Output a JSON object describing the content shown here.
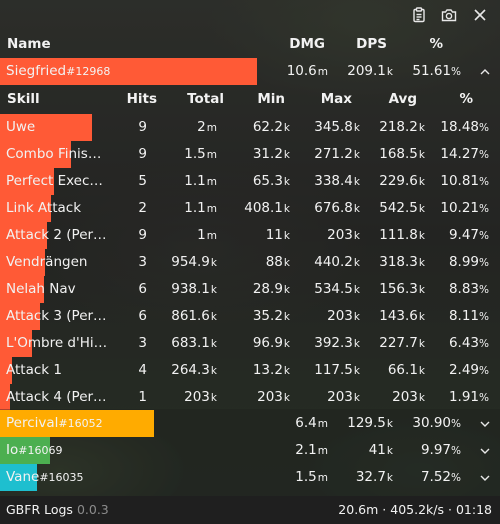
{
  "toolbar": {
    "icons": [
      "clipboard-icon",
      "camera-icon",
      "close-icon"
    ]
  },
  "header": {
    "name": "Name",
    "dmg": "DMG",
    "dps": "DPS",
    "pct": "%"
  },
  "players": [
    {
      "name": "Siegfried",
      "id": "#12968",
      "dmg": "10.6",
      "dmg_unit": "m",
      "dps": "209.1",
      "dps_unit": "k",
      "pct": "51.61",
      "share": 0.5161,
      "color": "#ff5a36",
      "expanded": true
    },
    {
      "name": "Percival",
      "id": "#16052",
      "dmg": "6.4",
      "dmg_unit": "m",
      "dps": "129.5",
      "dps_unit": "k",
      "pct": "30.90",
      "share": 0.309,
      "color": "#ffab00",
      "expanded": false
    },
    {
      "name": "Io",
      "id": "#16069",
      "dmg": "2.1",
      "dmg_unit": "m",
      "dps": "41",
      "dps_unit": "k",
      "pct": "9.97",
      "share": 0.0997,
      "color": "#4caf50",
      "expanded": false
    },
    {
      "name": "Vane",
      "id": "#16035",
      "dmg": "1.5",
      "dmg_unit": "m",
      "dps": "32.7",
      "dps_unit": "k",
      "pct": "7.52",
      "share": 0.0752,
      "color": "#1ebfcf",
      "expanded": false
    }
  ],
  "skill_header": {
    "skill": "Skill",
    "hits": "Hits",
    "total": "Total",
    "min": "Min",
    "max": "Max",
    "avg": "Avg",
    "pct": "%"
  },
  "skills": [
    {
      "name": "Uwe",
      "hits": "9",
      "total": [
        "2",
        "m"
      ],
      "min": [
        "62.2",
        "k"
      ],
      "max": [
        "345.8",
        "k"
      ],
      "avg": [
        "218.2",
        "k"
      ],
      "pct": "18.48",
      "share": 0.1848
    },
    {
      "name": "Combo Finis…",
      "hits": "9",
      "total": [
        "1.5",
        "m"
      ],
      "min": [
        "31.2",
        "k"
      ],
      "max": [
        "271.2",
        "k"
      ],
      "avg": [
        "168.5",
        "k"
      ],
      "pct": "14.27",
      "share": 0.1427
    },
    {
      "name": "Perfect Exec…",
      "hits": "5",
      "total": [
        "1.1",
        "m"
      ],
      "min": [
        "65.3",
        "k"
      ],
      "max": [
        "338.4",
        "k"
      ],
      "avg": [
        "229.6",
        "k"
      ],
      "pct": "10.81",
      "share": 0.1081
    },
    {
      "name": "Link Attack",
      "hits": "2",
      "total": [
        "1.1",
        "m"
      ],
      "min": [
        "408.1",
        "k"
      ],
      "max": [
        "676.8",
        "k"
      ],
      "avg": [
        "542.5",
        "k"
      ],
      "pct": "10.21",
      "share": 0.1021
    },
    {
      "name": "Attack 2 (Per…",
      "hits": "9",
      "total": [
        "1",
        "m"
      ],
      "min": [
        "11",
        "k"
      ],
      "max": [
        "203",
        "k"
      ],
      "avg": [
        "111.8",
        "k"
      ],
      "pct": "9.47",
      "share": 0.0947
    },
    {
      "name": "Vendrängen",
      "hits": "3",
      "total": [
        "954.9",
        "k"
      ],
      "min": [
        "88",
        "k"
      ],
      "max": [
        "440.2",
        "k"
      ],
      "avg": [
        "318.3",
        "k"
      ],
      "pct": "8.99",
      "share": 0.0899
    },
    {
      "name": "Nelah Nav",
      "hits": "6",
      "total": [
        "938.1",
        "k"
      ],
      "min": [
        "28.9",
        "k"
      ],
      "max": [
        "534.5",
        "k"
      ],
      "avg": [
        "156.3",
        "k"
      ],
      "pct": "8.83",
      "share": 0.0883
    },
    {
      "name": "Attack 3 (Per…",
      "hits": "6",
      "total": [
        "861.6",
        "k"
      ],
      "min": [
        "35.2",
        "k"
      ],
      "max": [
        "203",
        "k"
      ],
      "avg": [
        "143.6",
        "k"
      ],
      "pct": "8.11",
      "share": 0.0811
    },
    {
      "name": "L'Ombre d'Hi…",
      "hits": "3",
      "total": [
        "683.1",
        "k"
      ],
      "min": [
        "96.9",
        "k"
      ],
      "max": [
        "392.3",
        "k"
      ],
      "avg": [
        "227.7",
        "k"
      ],
      "pct": "6.43",
      "share": 0.0643
    },
    {
      "name": "Attack 1",
      "hits": "4",
      "total": [
        "264.3",
        "k"
      ],
      "min": [
        "13.2",
        "k"
      ],
      "max": [
        "117.5",
        "k"
      ],
      "avg": [
        "66.1",
        "k"
      ],
      "pct": "2.49",
      "share": 0.0249
    },
    {
      "name": "Attack 4 (Per…",
      "hits": "1",
      "total": [
        "203",
        "k"
      ],
      "min": [
        "203",
        "k"
      ],
      "max": [
        "203",
        "k"
      ],
      "avg": [
        "203",
        "k"
      ],
      "pct": "1.91",
      "share": 0.0191
    }
  ],
  "footer": {
    "app_name": "GBFR Logs",
    "version": "0.0.3",
    "total_dmg": "20.6m",
    "total_dps": "405.2k/s",
    "duration": "01:18",
    "sep": "·"
  }
}
